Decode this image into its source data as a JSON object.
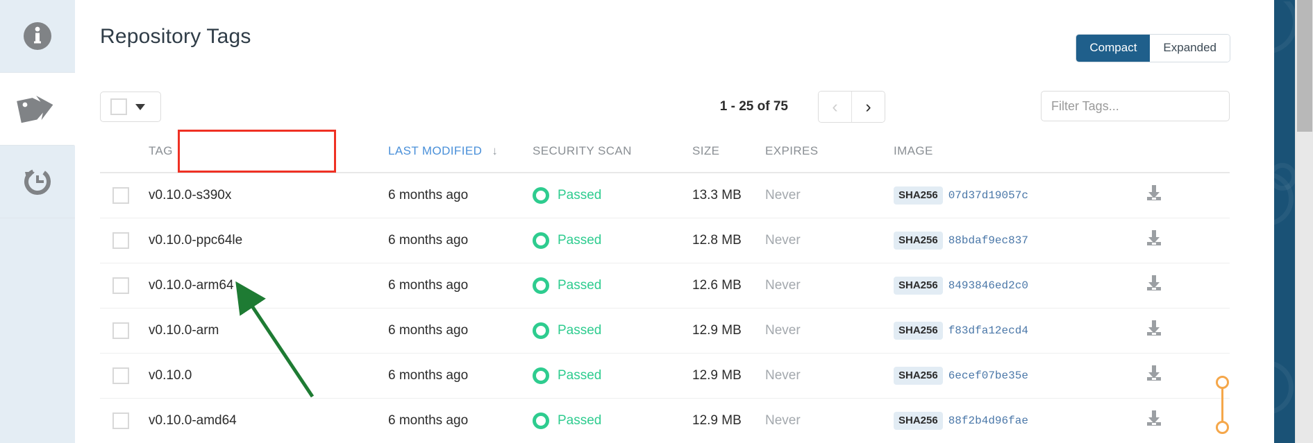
{
  "header": {
    "title": "Repository Tags",
    "view_toggle": [
      {
        "label": "Compact",
        "selected": true
      },
      {
        "label": "Expanded",
        "selected": false
      }
    ]
  },
  "toolbar": {
    "bulk_select_icon": "checkbox-with-caret",
    "range_label": "1 - 25 of 75",
    "prev_label": "‹",
    "next_label": "›",
    "filter_placeholder": "Filter Tags...",
    "filter_value": ""
  },
  "sidebar": {
    "items": [
      {
        "name": "information",
        "icon": "info-circle-icon",
        "active": false
      },
      {
        "name": "tags",
        "icon": "tag-icon",
        "active": true
      },
      {
        "name": "history",
        "icon": "history-clock-icon",
        "active": false
      }
    ]
  },
  "table": {
    "columns": [
      {
        "key": "checkbox",
        "label": ""
      },
      {
        "key": "tag",
        "label": "TAG",
        "sortable": true,
        "highlighted": true
      },
      {
        "key": "last_modified",
        "label": "LAST MODIFIED",
        "sortable": true,
        "active_sort": true,
        "sort_dir": "desc"
      },
      {
        "key": "security_scan",
        "label": "SECURITY SCAN"
      },
      {
        "key": "size",
        "label": "SIZE"
      },
      {
        "key": "expires",
        "label": "EXPIRES"
      },
      {
        "key": "image",
        "label": "IMAGE"
      },
      {
        "key": "download",
        "label": ""
      }
    ],
    "rows": [
      {
        "tag": "v0.10.0-s390x",
        "last_modified": "6 months ago",
        "scan": "Passed",
        "size": "13.3 MB",
        "expires": "Never",
        "sha_label": "SHA256",
        "digest": "07d37d19057c",
        "checked": false
      },
      {
        "tag": "v0.10.0-ppc64le",
        "last_modified": "6 months ago",
        "scan": "Passed",
        "size": "12.8 MB",
        "expires": "Never",
        "sha_label": "SHA256",
        "digest": "88bdaf9ec837",
        "checked": false
      },
      {
        "tag": "v0.10.0-arm64",
        "last_modified": "6 months ago",
        "scan": "Passed",
        "size": "12.6 MB",
        "expires": "Never",
        "sha_label": "SHA256",
        "digest": "8493846ed2c0",
        "checked": false
      },
      {
        "tag": "v0.10.0-arm",
        "last_modified": "6 months ago",
        "scan": "Passed",
        "size": "12.9 MB",
        "expires": "Never",
        "sha_label": "SHA256",
        "digest": "f83dfa12ecd4",
        "checked": false
      },
      {
        "tag": "v0.10.0",
        "last_modified": "6 months ago",
        "scan": "Passed",
        "size": "12.9 MB",
        "expires": "Never",
        "sha_label": "SHA256",
        "digest": "6ecef07be35e",
        "checked": false,
        "group_connector": "start"
      },
      {
        "tag": "v0.10.0-amd64",
        "last_modified": "6 months ago",
        "scan": "Passed",
        "size": "12.9 MB",
        "expires": "Never",
        "sha_label": "SHA256",
        "digest": "88f2b4d96fae",
        "checked": false,
        "group_connector": "end"
      }
    ]
  },
  "annotations": {
    "tag_header_box": {
      "color": "#ef3124",
      "target": "TAG"
    },
    "arrow": {
      "color": "#1e7b33",
      "points_to": "v0.10.0-arm64"
    }
  },
  "colors": {
    "accent_blue": "#1f5f8b",
    "link_blue": "#4a90d9",
    "scan_green": "#2ecc8f",
    "connector_orange": "#f5a74a",
    "sidebar_bg": "#e4edf4",
    "annotation_red": "#ef3124",
    "annotation_green": "#1e7b33"
  }
}
